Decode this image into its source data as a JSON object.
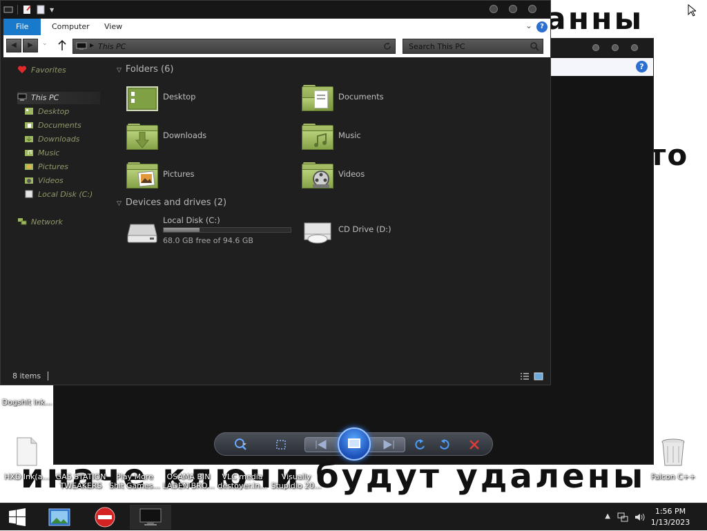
{
  "wallpaper": {
    "line_top": "анны",
    "line_mid": "то",
    "line_bottom": "иначе ключи будут удалены"
  },
  "background_window": {
    "help_label": "?"
  },
  "explorer": {
    "ribbon": {
      "tabs": [
        "File",
        "Computer",
        "View"
      ],
      "help_label": "?"
    },
    "address": {
      "path": "This PC"
    },
    "search": {
      "placeholder": "Search This PC"
    },
    "nav": {
      "favorites": "Favorites",
      "this_pc": "This PC",
      "items": [
        "Desktop",
        "Documents",
        "Downloads",
        "Music",
        "Pictures",
        "Videos",
        "Local Disk (C:)"
      ],
      "network": "Network"
    },
    "folders_header": "Folders (6)",
    "folders": [
      {
        "name": "Desktop",
        "icon": "desktop-folder-icon"
      },
      {
        "name": "Documents",
        "icon": "documents-folder-icon"
      },
      {
        "name": "Downloads",
        "icon": "downloads-folder-icon"
      },
      {
        "name": "Music",
        "icon": "music-folder-icon"
      },
      {
        "name": "Pictures",
        "icon": "pictures-folder-icon"
      },
      {
        "name": "Videos",
        "icon": "videos-folder-icon"
      }
    ],
    "devices_header": "Devices and drives (2)",
    "drives": [
      {
        "name": "Local Disk (C:)",
        "free_text": "68.0 GB free of 94.6 GB",
        "used_fraction": 0.28
      },
      {
        "name": "CD Drive (D:)"
      }
    ],
    "status": {
      "items_count": "8 items"
    }
  },
  "desktop_icons": [
    {
      "label": "Dogshit lnk..."
    },
    {
      "label": "HXD lnk(a..."
    },
    {
      "label": "GAS STATION TWEAKERS I..."
    },
    {
      "label": "Play More Shit Games..."
    },
    {
      "label": "OSAMA BIN LADEN BRO..."
    },
    {
      "label": "VLC media destoyer.ln..."
    },
    {
      "label": "Visually Stupidio 20..."
    },
    {
      "label": "Falcon C++"
    }
  ],
  "taskbar": {
    "clock_time": "1:56 PM",
    "clock_date": "1/13/2023"
  },
  "colors": {
    "explorer_bg": "#1f1f1f",
    "accent_file_tab": "#1979ca",
    "folder_green": "#9db85e",
    "taskbar": "#1a1a1a"
  }
}
